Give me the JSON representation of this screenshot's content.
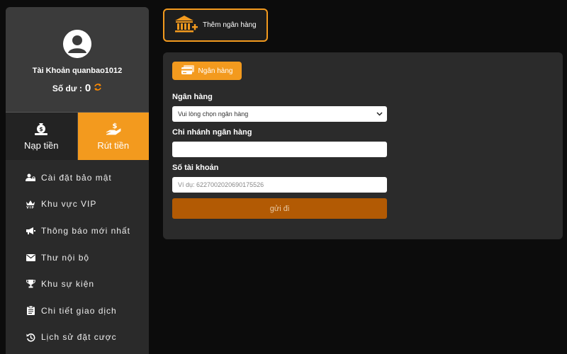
{
  "profile": {
    "username": "Tài Khoản quanbao1012",
    "balance_label": "Số dư :",
    "balance_value": "0"
  },
  "actions": {
    "deposit_label": "Nạp tiền",
    "withdraw_label": "Rút tiền"
  },
  "menu": [
    {
      "label": "Cài đặt bảo mật",
      "icon": "user-lock-icon"
    },
    {
      "label": "Khu vực VIP",
      "icon": "vip-crown-icon"
    },
    {
      "label": "Thông báo mới nhất",
      "icon": "megaphone-icon"
    },
    {
      "label": "Thư nội bộ",
      "icon": "envelope-icon"
    },
    {
      "label": "Khu sự kiện",
      "icon": "trophy-icon"
    },
    {
      "label": "Chi tiết giao dịch",
      "icon": "clipboard-icon"
    },
    {
      "label": "Lịch sử đặt cược",
      "icon": "history-icon"
    }
  ],
  "add_bank_label": "Thêm ngân hàng",
  "panel": {
    "tab_label": "Ngân hàng",
    "bank_label": "Ngân hàng",
    "bank_select_value": "Vui lòng chọn ngân hàng",
    "branch_label": "Chi nhánh ngân hàng",
    "branch_value": "",
    "account_label": "Số tài khoản",
    "account_placeholder": "Ví dụ: 6227002020690175526",
    "submit_label": "gửi đi"
  },
  "colors": {
    "accent": "#f39a1e",
    "submit": "#b25a04",
    "background": "#0c0c0c",
    "sidebar": "#2a2a2a"
  }
}
